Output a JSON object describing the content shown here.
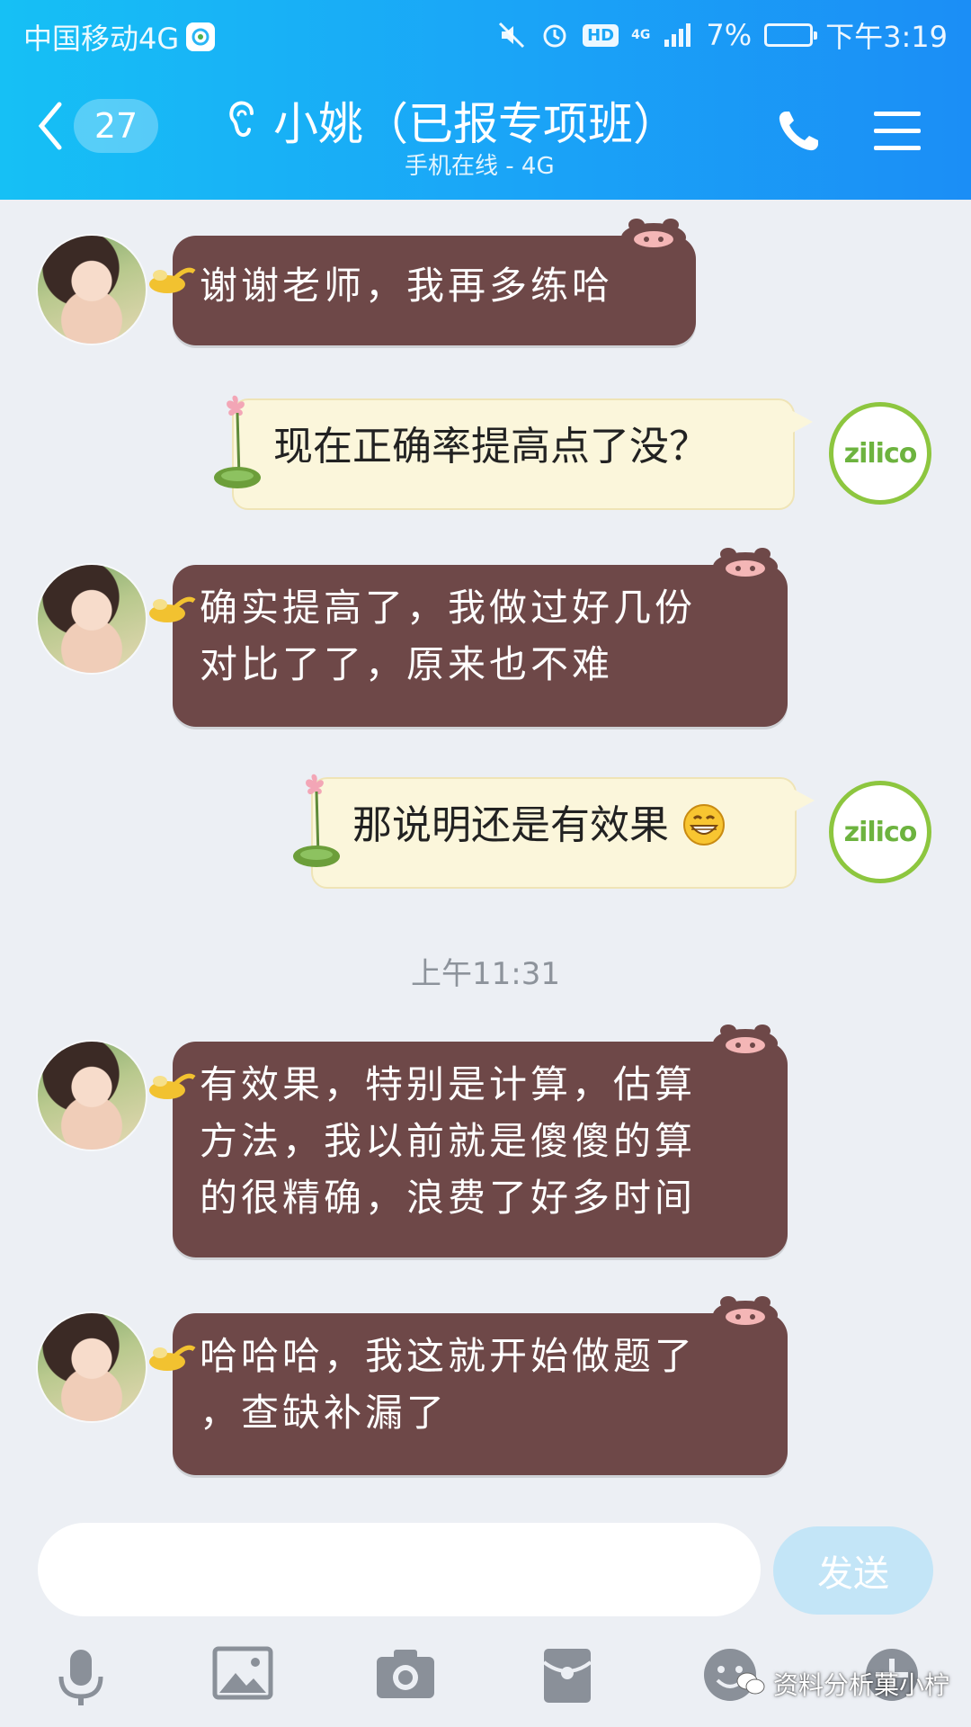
{
  "status_bar": {
    "carrier": "中国移动4G",
    "network": "4G",
    "battery": "7%",
    "time": "下午3:19",
    "hd": "HD"
  },
  "header": {
    "unread_count": "27",
    "contact_name": "小姚（已报专项班）",
    "online_status": "手机在线 - 4G"
  },
  "messages": [
    {
      "side": "left",
      "text": "谢谢老师，我再多练哈"
    },
    {
      "side": "right",
      "text": "现在正确率提高点了没？"
    },
    {
      "side": "left",
      "lines": [
        "确实提高了，我做过好几份",
        "对比了了，原来也不难"
      ]
    },
    {
      "side": "right",
      "text": "那说明还是有效果"
    },
    {
      "side": "left",
      "lines": [
        "有效果，特别是计算，估算",
        "方法，我以前就是傻傻的算",
        "的很精确，浪费了好多时间"
      ]
    },
    {
      "side": "left",
      "lines": [
        "哈哈哈，我这就开始做题了",
        "，查缺补漏了"
      ]
    }
  ],
  "timestamp": "上午11:31",
  "avatar_right_logo": "zilico",
  "input": {
    "value": "",
    "placeholder": ""
  },
  "send_label": "发送",
  "watermark": "资料分析菓小柠",
  "colors": {
    "header": "#1aa6f7",
    "left_bubble": "#6e4848",
    "right_bubble": "#fbf6db",
    "background": "#eceff4",
    "send_button": "#c3e5f7"
  },
  "icons": [
    "back-chevron-icon",
    "ear-icon",
    "phone-icon",
    "menu-icon",
    "microphone-icon",
    "image-icon",
    "camera-icon",
    "red-packet-icon",
    "emoji-icon",
    "plus-icon"
  ]
}
